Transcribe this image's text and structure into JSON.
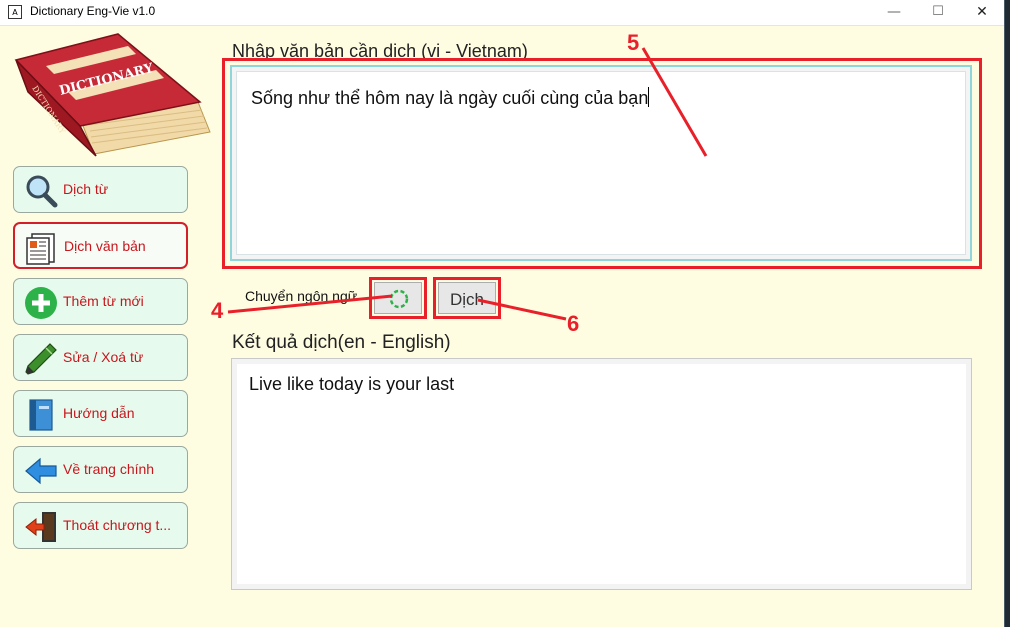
{
  "window": {
    "title": "Dictionary Eng-Vie v1.0",
    "icon_text": "A",
    "controls": {
      "minimize": "—",
      "maximize": "☐",
      "close": "✕"
    }
  },
  "logo": {
    "text": "DICTIONARY",
    "spine_text": "DICTIONARY"
  },
  "sidebar": {
    "items": [
      {
        "label": "Dịch từ",
        "icon": "magnifier-icon",
        "active": false
      },
      {
        "label": "Dịch văn bản",
        "icon": "document-icon",
        "active": true
      },
      {
        "label": "Thêm từ mới",
        "icon": "plus-icon",
        "active": false
      },
      {
        "label": "Sửa / Xoá từ",
        "icon": "pen-icon",
        "active": false
      },
      {
        "label": "Hướng dẫn",
        "icon": "book-icon",
        "active": false
      },
      {
        "label": "Về trang chính",
        "icon": "arrow-left-icon",
        "active": false
      },
      {
        "label": "Thoát chương t...",
        "icon": "exit-door-icon",
        "active": false
      }
    ]
  },
  "input": {
    "label": "Nhập văn bản cần dịch (vi - Vietnam)",
    "value": "Sống như thể hôm nay là ngày cuối cùng của bạn"
  },
  "controls": {
    "swap_label": "Chuyển ngôn ngữ",
    "translate_label": "Dịch"
  },
  "result": {
    "label": "Kết quả dịch(en - English)",
    "value": "Live like today is your last"
  },
  "annotations": {
    "swap_marker": "4",
    "input_marker": "5",
    "translate_marker": "6",
    "color": "#e8202a"
  },
  "colors": {
    "background": "#fffde1",
    "sidebar_button": "#e6fbee",
    "sidebar_text": "#c8161d",
    "highlight": "#e8202a"
  }
}
